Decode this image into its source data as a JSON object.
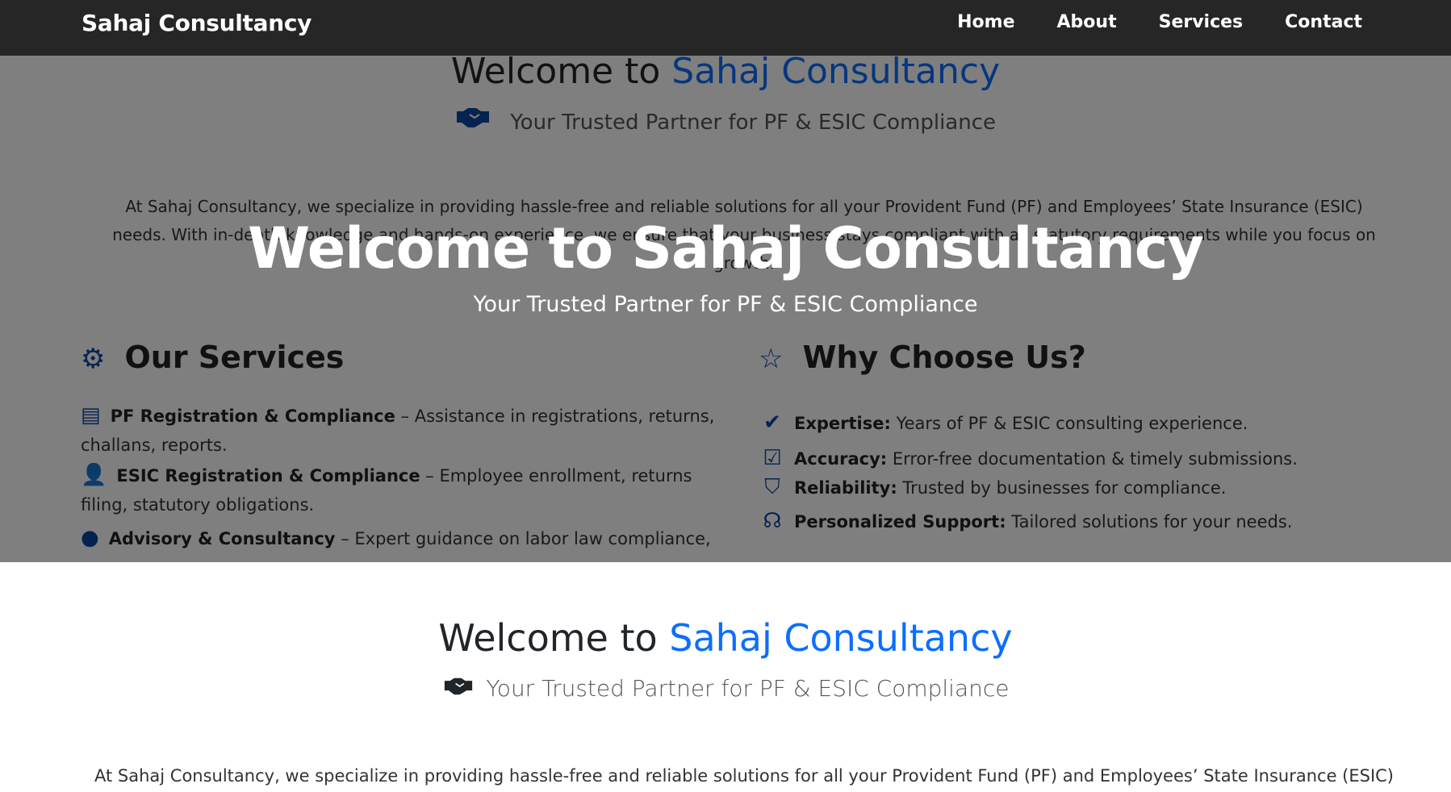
{
  "brand": "Sahaj Consultancy",
  "nav": {
    "home": "Home",
    "about": "About",
    "services": "Services",
    "contact": "Contact"
  },
  "welcome": {
    "prefix": "Welcome to ",
    "name": "Sahaj Consultancy",
    "tagline": "Your Trusted Partner for PF & ESIC Compliance",
    "intro_line1": "At Sahaj Consultancy, we specialize in providing hassle-free and reliable solutions for all your Provident Fund (PF) and Employees’ State Insurance (ESIC)",
    "intro_line2": "needs. With in-depth knowledge and hands-on experience, we ensure that your business stays compliant with all statutory requirements while you focus on",
    "intro_line3": "growth."
  },
  "services": {
    "title": "Our Services",
    "items": [
      {
        "name": "PF Registration & Compliance",
        "desc": " – Assistance in registrations, returns, challans, reports."
      },
      {
        "name": "ESIC Registration & Compliance",
        "desc": " – Employee enrollment, returns filing, statutory obligations."
      },
      {
        "name": "Advisory & Consultancy",
        "desc": " – Expert guidance on labor law compliance,"
      }
    ]
  },
  "why": {
    "title": "Why Choose Us?",
    "items": [
      {
        "name": "Expertise:",
        "desc": " Years of PF & ESIC consulting experience."
      },
      {
        "name": "Accuracy:",
        "desc": " Error-free documentation & timely submissions."
      },
      {
        "name": "Reliability:",
        "desc": " Trusted by businesses for compliance."
      },
      {
        "name": "Personalized Support:",
        "desc": " Tailored solutions for your needs."
      }
    ]
  },
  "hero": {
    "title": "Welcome to Sahaj Consultancy",
    "subtitle": "Your Trusted Partner for PF & ESIC Compliance"
  },
  "icons": {
    "handshake": "handshake-icon",
    "gear": "gear-icon",
    "star": "star-icon",
    "document": "document-icon",
    "user_shield": "user-shield-icon",
    "lightbulb": "lightbulb-icon",
    "badge_check": "badge-check-icon",
    "clipboard_check": "clipboard-check-icon",
    "shield": "shield-icon",
    "headset": "headset-icon"
  },
  "colors": {
    "accent": "#0d6efd",
    "icon_blue": "#0d47a1",
    "navbar": "#262626"
  }
}
